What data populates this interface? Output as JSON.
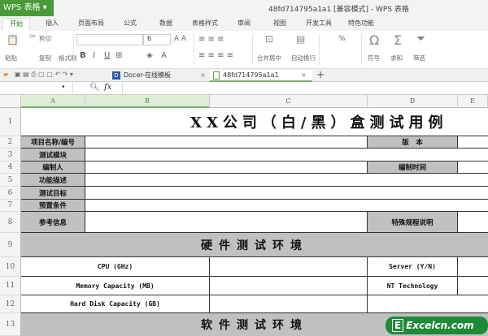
{
  "app": {
    "name": "WPS 表格",
    "window_title": "48fd714795a1a1 [兼容模式] - WPS 表格"
  },
  "ribbon_tabs": [
    "开始",
    "插入",
    "页面布局",
    "公式",
    "数据",
    "表格样式",
    "审阅",
    "视图",
    "开发工具",
    "特色功能"
  ],
  "ribbon": {
    "paste": "粘贴",
    "cut": "剪切",
    "copy": "复制",
    "format_painter": "格式刷",
    "font_size": "6",
    "bold": "B",
    "italic": "I",
    "underline": "U",
    "merge_center": "合并居中",
    "wrap_text": "自动换行",
    "percent": "%",
    "symbol": "符号",
    "sum": "求和",
    "filter": "筛选"
  },
  "doc_tabs": [
    {
      "label": "Docer-在线模板"
    },
    {
      "label": "48fd714795a1a1",
      "active": true
    }
  ],
  "formula_bar": {
    "fx": "fx",
    "value": ""
  },
  "columns": [
    "A",
    "B",
    "C",
    "D",
    "E"
  ],
  "rows": [
    "1",
    "2",
    "3",
    "4",
    "5",
    "6",
    "7",
    "8",
    "9",
    "10",
    "11",
    "12",
    "13"
  ],
  "sheet": {
    "title": "XX公司（白/黑）盒测试用例",
    "labels": {
      "project": "项目名称/编号",
      "module": "测试模块",
      "author": "编制人",
      "func": "功能描述",
      "goal": "测试目标",
      "precond": "预置条件",
      "ref": "参考信息",
      "version": "版　本",
      "date": "编制时间",
      "special": "特殊规程说明"
    },
    "hw_header": "硬件测试环境",
    "cpu": "CPU (GHz)",
    "memory": "Memory Capacity (MB)",
    "disk": "Hard Disk Capacity (GB)",
    "server": "Server (Y/N)",
    "nt": "NT Technology",
    "sw_header": "软件测试环境"
  },
  "watermark": "Excelcn.com"
}
